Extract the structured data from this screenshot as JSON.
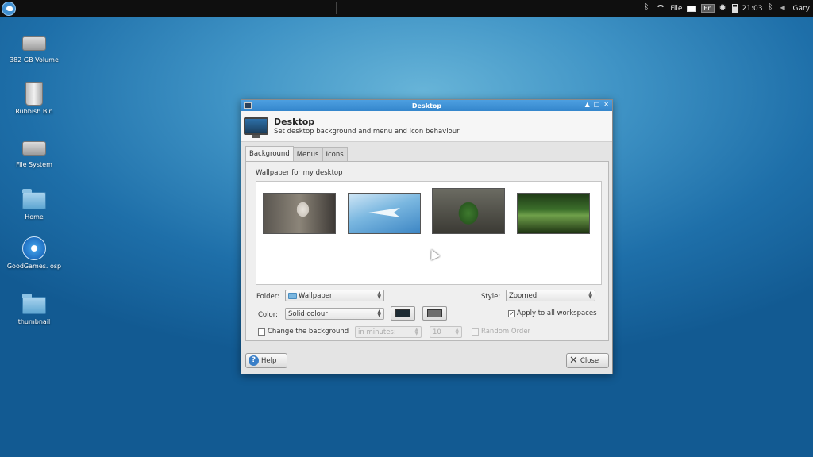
{
  "panel": {
    "menu_label": "File",
    "lang": "En",
    "clock": "21:03",
    "user": "Gary"
  },
  "desktop_icons": [
    {
      "label": "382 GB Volume",
      "icon": "drive-icon"
    },
    {
      "label": "Rubbish Bin",
      "icon": "trash-icon"
    },
    {
      "label": "File System",
      "icon": "drive-icon"
    },
    {
      "label": "Home",
      "icon": "home-folder-icon"
    },
    {
      "label": "GoodGames. osp",
      "icon": "media-disc-icon"
    },
    {
      "label": "thumbnail",
      "icon": "folder-icon"
    }
  ],
  "dialog": {
    "window_title": "Desktop",
    "header_title": "Desktop",
    "header_subtitle": "Set desktop background and menu and icon behaviour",
    "tabs": [
      "Background",
      "Menus",
      "Icons"
    ],
    "active_tab": "Background",
    "wallpaper_label": "Wallpaper for my desktop",
    "folder_label": "Folder:",
    "folder_value": "Wallpaper",
    "style_label": "Style:",
    "style_value": "Zoomed",
    "color_label": "Color:",
    "color_value": "Solid colour",
    "apply_all_label": "Apply to all workspaces",
    "apply_all_checked": true,
    "change_bg_label": "Change the background",
    "change_bg_checked": false,
    "interval_unit": "in minutes:",
    "interval_value": "10",
    "random_order_label": "Random Order",
    "help_label": "Help",
    "close_label": "Close",
    "primary_color": "#1c2a33",
    "secondary_color": "#6e6e6e"
  },
  "colors": {
    "titlebar": "#3a8ad0",
    "desktop": "#2a7ab5"
  }
}
